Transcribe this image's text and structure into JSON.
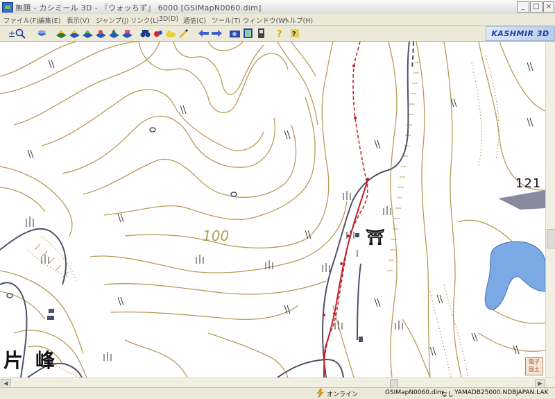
{
  "window": {
    "title": "無題 - カシミール 3D - 『ウォッちず』 6000 [GSIMapN0060.dim]",
    "minimize_label": "_",
    "maximize_label": "□",
    "close_label": "×"
  },
  "menu": {
    "items": [
      {
        "label": "ファイル(F)"
      },
      {
        "label": "編集(E)"
      },
      {
        "label": "表示(V)"
      },
      {
        "label": "ジャンプ(J)"
      },
      {
        "label": "リンク(L)"
      },
      {
        "label": "3D(D)"
      },
      {
        "label": "通信(C)"
      },
      {
        "label": "ツール(T)"
      },
      {
        "label": "ウィンドウ(W)"
      },
      {
        "label": "ヘルプ(H)"
      }
    ]
  },
  "toolbar": {
    "brand": "KASHMIR 3D"
  },
  "map": {
    "contour_label": "100",
    "place_name": "片峰",
    "elevation_label": "121",
    "shrine_symbol": "⛩",
    "gsi_logo_line1": "電子",
    "gsi_logo_line2": "国土",
    "colors": {
      "contour": "#b79a5a",
      "road": "#4d5068",
      "water": "#7aa9e6",
      "route": "#c0202a"
    }
  },
  "status": {
    "online": "オンライン",
    "map_file": "GSIMapN0060.dim",
    "none": "なし",
    "ndb": "YAMADB25000.NDB",
    "lak": "JAPAN.LAK"
  }
}
